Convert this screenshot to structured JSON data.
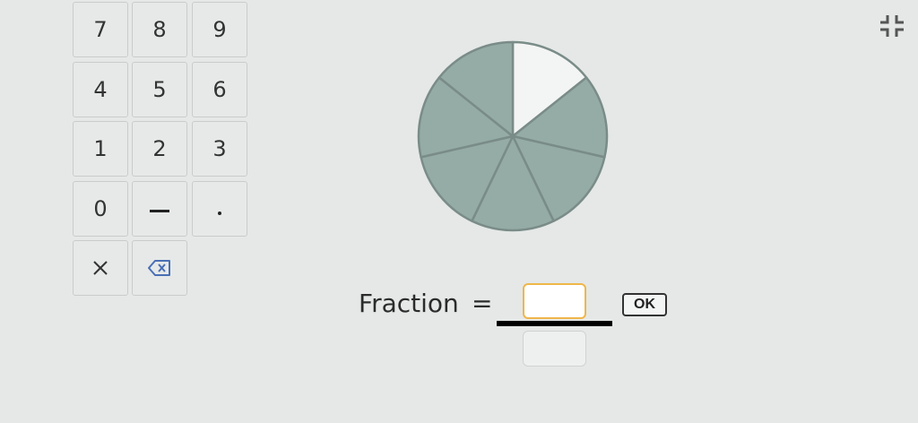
{
  "keypad": {
    "keys": [
      "7",
      "8",
      "9",
      "4",
      "5",
      "6",
      "1",
      "2",
      "3",
      "0"
    ],
    "minus_icon": "minus-icon",
    "decimal_icon": "decimal-point-icon",
    "close_icon": "close-icon",
    "backspace_icon": "backspace-icon"
  },
  "toolbar": {
    "collapse_icon": "collapse-icon"
  },
  "pie": {
    "total_slices": 7,
    "unshaded_slices": 1,
    "shaded_color": "#95aba6",
    "unshaded_color": "#f3f5f4",
    "stroke_color": "#7a8c88"
  },
  "fraction": {
    "label": "Fraction",
    "equals": "=",
    "numerator_value": "",
    "denominator_value": "",
    "ok_label": "OK"
  }
}
